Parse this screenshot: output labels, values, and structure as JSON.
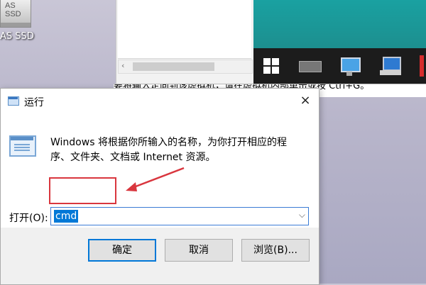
{
  "desktop": {
    "icon_label": "AS SSD",
    "icon_drive_text": "AS SSD"
  },
  "background_status_text": "要将输入定向到该虚拟机，请在虚拟机内部单击或按 Ctrl+G。",
  "dialog": {
    "title": "运行",
    "close_glyph": "×",
    "description": "Windows 将根据你所输入的名称，为你打开相应的程序、文件夹、文档或 Internet 资源。",
    "open_label": "打开(O):",
    "input_value": "cmd",
    "buttons": {
      "ok": "确定",
      "cancel": "取消",
      "browse": "浏览(B)..."
    }
  },
  "colors": {
    "annotation_red": "#d9363e",
    "accent_blue": "#0078d7"
  }
}
